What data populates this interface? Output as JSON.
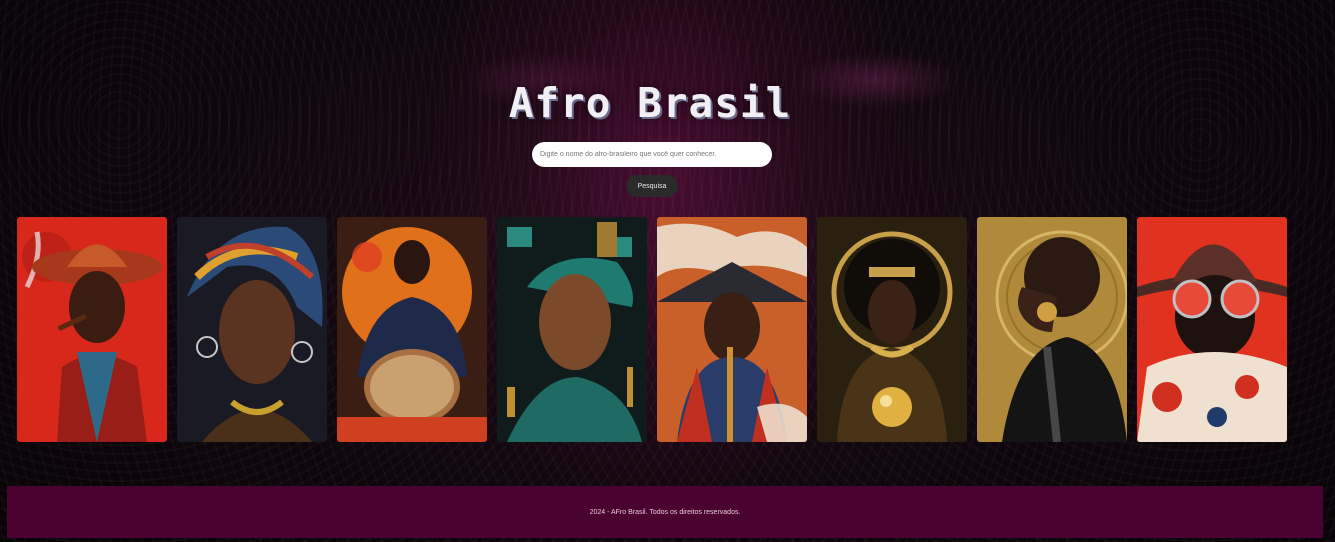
{
  "header": {
    "title": "Afro Brasil"
  },
  "search": {
    "placeholder": "Digite o nome do afro-brasileiro que você quer conhecer.",
    "value": ""
  },
  "search_button": {
    "label": "Pesquisa"
  },
  "gallery": {
    "cards": [
      {
        "subject": "man with pipe and hat",
        "bg": "#d8281c"
      },
      {
        "subject": "woman with headwrap",
        "bg": "#2a3550"
      },
      {
        "subject": "drummer",
        "bg": "#e0701a"
      },
      {
        "subject": "woman teal geometric",
        "bg": "#1f5a58"
      },
      {
        "subject": "man with conical hat",
        "bg": "#c9602a"
      },
      {
        "subject": "woman with golden orb",
        "bg": "#3a2a12"
      },
      {
        "subject": "woman in profile gold halo",
        "bg": "#b08a3a"
      },
      {
        "subject": "man with red sunglasses",
        "bg": "#e0321e"
      }
    ]
  },
  "footer": {
    "text": "2024 - AFro Brasil. Todos os direitos reservados."
  }
}
